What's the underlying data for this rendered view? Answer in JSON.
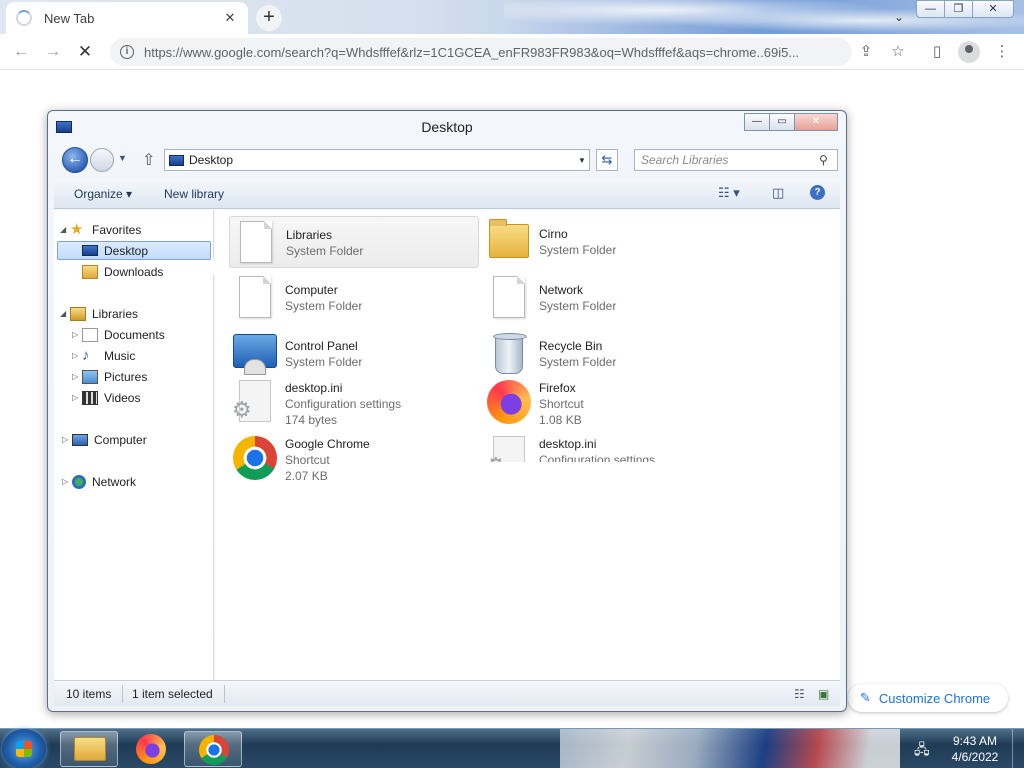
{
  "browser": {
    "tab": {
      "title": "New Tab",
      "close": "✕"
    },
    "new_tab": "+",
    "tab_search": "⌄",
    "window_controls": {
      "minimize": "—",
      "maximize": "❐",
      "close": "✕"
    },
    "nav": {
      "back": "←",
      "forward": "→",
      "stop": "✕"
    },
    "url": "https://www.google.com/search?q=Whdsfffef&rlz=1C1GCEA_enFR983FR983&oq=Whdsfffef&aqs=chrome..69i5...",
    "icons": {
      "share": "⇪",
      "bookmark": "☆",
      "side_panel": "▯",
      "menu": "⋮"
    },
    "customize_label": "Customize Chrome",
    "customize_icon": "✎"
  },
  "explorer": {
    "title": "Desktop",
    "controls": {
      "minimize": "—",
      "maximize": "▭",
      "close": "✕"
    },
    "address": "Desktop",
    "search_placeholder": "Search Libraries",
    "search_icon": "⚲",
    "back_icon": "←",
    "up_icon": "⇧",
    "refresh_icon": "⇆",
    "dropdown_icon": "▼",
    "commands": {
      "organize": "Organize ▾",
      "new_library": "New library",
      "views_icon": "☷ ▾",
      "pane_icon": "◫",
      "help": "?"
    },
    "nav": {
      "favorites": "Favorites",
      "desktop": "Desktop",
      "downloads": "Downloads",
      "libraries": "Libraries",
      "documents": "Documents",
      "music": "Music",
      "pictures": "Pictures",
      "videos": "Videos",
      "computer": "Computer",
      "network": "Network"
    },
    "items": [
      {
        "name": "Libraries",
        "sub": "System Folder",
        "sub2": "",
        "icon": "doc"
      },
      {
        "name": "Cirno",
        "sub": "System Folder",
        "sub2": "",
        "icon": "folder"
      },
      {
        "name": "Computer",
        "sub": "System Folder",
        "sub2": "",
        "icon": "doc"
      },
      {
        "name": "Network",
        "sub": "System Folder",
        "sub2": "",
        "icon": "doc"
      },
      {
        "name": "Control Panel",
        "sub": "System Folder",
        "sub2": "",
        "icon": "control-panel"
      },
      {
        "name": "Recycle Bin",
        "sub": "System Folder",
        "sub2": "",
        "icon": "recycle-bin"
      },
      {
        "name": "desktop.ini",
        "sub": "Configuration settings",
        "sub2": "174 bytes",
        "icon": "config-file"
      },
      {
        "name": "Firefox",
        "sub": "Shortcut",
        "sub2": "1.08 KB",
        "icon": "firefox"
      },
      {
        "name": "Google Chrome",
        "sub": "Shortcut",
        "sub2": "2.07 KB",
        "icon": "chrome"
      },
      {
        "name": "desktop.ini",
        "sub": "Configuration settings",
        "sub2": "",
        "icon": "config-file"
      }
    ],
    "status": {
      "count": "10 items",
      "selected": "1 item selected"
    }
  },
  "taskbar": {
    "time": "9:43 AM",
    "date": "4/6/2022",
    "network_icon": "🖧"
  }
}
